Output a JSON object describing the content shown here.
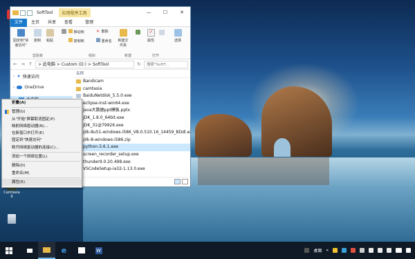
{
  "desktop": {
    "icons": [
      {
        "label": "",
        "icon": "app-icon"
      },
      {
        "label": "Camtasia 9",
        "icon": "camtasia-icon"
      },
      {
        "label": "",
        "icon": "recycle-bin-icon"
      }
    ]
  },
  "window": {
    "title": "SoftTool",
    "tool_tab": "应用程序工具",
    "tabs": [
      "文件",
      "主页",
      "共享",
      "查看",
      "管理"
    ],
    "ribbon": {
      "pin_label": "固定到\"快速访问\"",
      "copy_label": "复制",
      "paste_label": "粘贴",
      "move_to_label": "移动到",
      "copy_to_label": "复制到",
      "delete_label": "删除",
      "rename_label": "重命名",
      "new_folder_label": "新建文件夹",
      "properties_label": "属性",
      "select_label": "选择",
      "groups": [
        "剪贴板",
        "组织",
        "新建",
        "打开"
      ]
    },
    "address": {
      "path": "> 此电脑 > Custom (D:) > SoftTool",
      "search_placeholder": "搜索\"SoftT...",
      "back": "←",
      "forward": "→",
      "up": "↑",
      "refresh": "↻"
    },
    "nav_pane": {
      "quick_access": "快速访问",
      "onedrive": "OneDrive",
      "this_pc": "此电脑"
    },
    "file_list": {
      "column_name": "名称",
      "files": [
        "Bandicam",
        "camtasia",
        "BaiduNetdisk_5.5.0.exe",
        "eclipse-inst-win64.exe",
        "Java大数据ppt模板.pptx",
        "JDK_1.8.0_64bit.exe",
        "JDK_31@79926.exe",
        "jdk-8u51-windows-i586_V8.0.510.16_14459_BDdl.exe",
        "jdk-8-windows-i586.zip",
        "python-3.6.1.exe",
        "screen_recorder_setup.exe",
        "thunder9.0.20.498.exe",
        "VSCodeSetup-ia32-1.13.0.exe"
      ],
      "selected_index": 9
    }
  },
  "context_menu": {
    "items": [
      {
        "label": "折叠(A)",
        "bold": true
      },
      {
        "sep": true
      },
      {
        "label": "管理(G)",
        "shield": true
      },
      {
        "label": "从\"开始\"屏幕取消固定(P)"
      },
      {
        "label": "映射网络驱动器(N)..."
      },
      {
        "label": "在新窗口中打开(E)"
      },
      {
        "label": "固定到\"快速访问\""
      },
      {
        "label": "断开网络驱动器的连接(C)..."
      },
      {
        "sep": true
      },
      {
        "label": "添加一个网络位置(L)"
      },
      {
        "sep": true
      },
      {
        "label": "删除(D)"
      },
      {
        "label": "重命名(M)"
      },
      {
        "sep": true
      },
      {
        "label": "属性(R)",
        "highlight": true
      }
    ]
  },
  "taskbar": {
    "apps": [
      "start",
      "file-explorer",
      "edge",
      "store",
      "word",
      "task"
    ],
    "active_index": 1,
    "desktop_label": "桌面",
    "show_desktop_arrow": "«"
  }
}
